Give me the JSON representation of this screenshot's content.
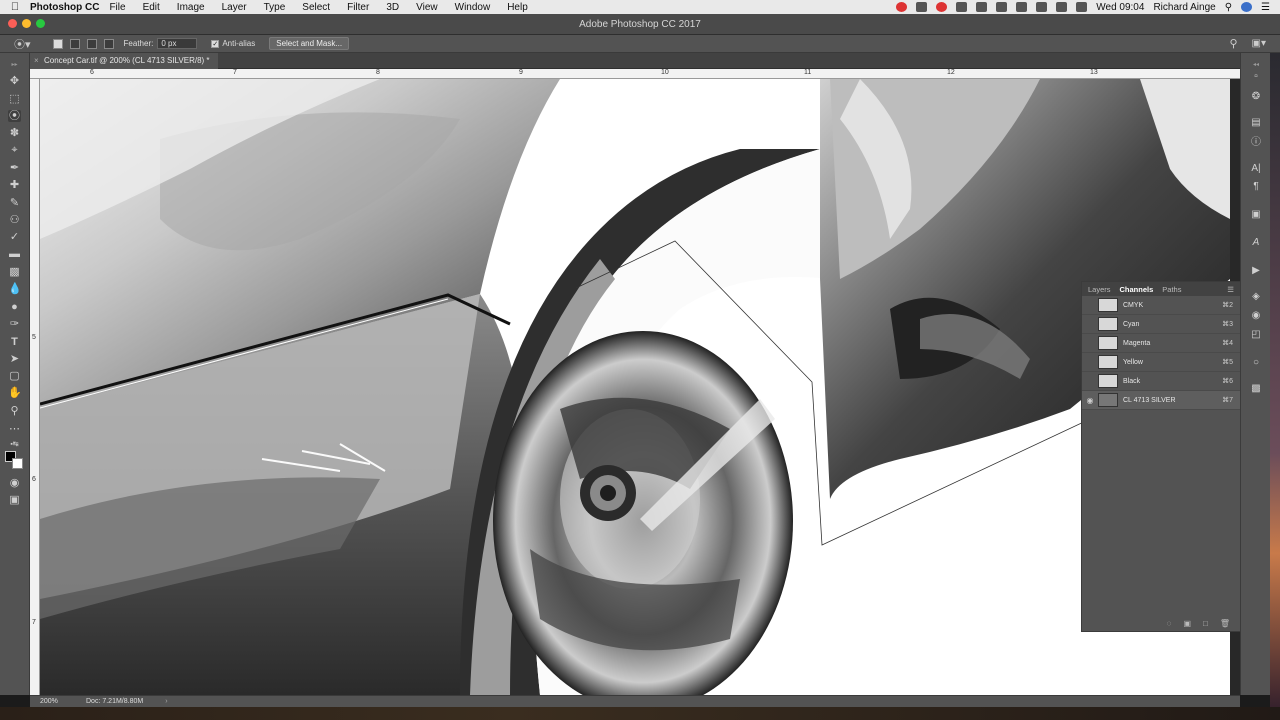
{
  "menubar": {
    "app_name": "Photoshop CC",
    "menus": [
      "File",
      "Edit",
      "Image",
      "Layer",
      "Type",
      "Select",
      "Filter",
      "3D",
      "View",
      "Window",
      "Help"
    ],
    "clock": "Wed 09:04",
    "user": "Richard Ainge"
  },
  "window": {
    "title": "Adobe Photoshop CC 2017"
  },
  "options": {
    "feather_label": "Feather:",
    "feather_value": "0 px",
    "antialias_label": "Anti-alias",
    "antialias_checked": true,
    "select_mask_label": "Select and Mask..."
  },
  "document": {
    "tab_title": "Concept Car.tif @ 200% (CL 4713 SILVER/8) *",
    "close_glyph": "×"
  },
  "rulers": {
    "horizontal": [
      "6",
      "7",
      "8",
      "9",
      "10",
      "11",
      "12",
      "13"
    ],
    "vertical": [
      "5",
      "6",
      "7"
    ]
  },
  "panel": {
    "tabs": [
      "Layers",
      "Channels",
      "Paths"
    ],
    "active_tab": "Channels",
    "channels": [
      {
        "name": "CMYK",
        "shortcut": "⌘2",
        "visible": false,
        "selected": false
      },
      {
        "name": "Cyan",
        "shortcut": "⌘3",
        "visible": false,
        "selected": false
      },
      {
        "name": "Magenta",
        "shortcut": "⌘4",
        "visible": false,
        "selected": false
      },
      {
        "name": "Yellow",
        "shortcut": "⌘5",
        "visible": false,
        "selected": false
      },
      {
        "name": "Black",
        "shortcut": "⌘6",
        "visible": false,
        "selected": false
      },
      {
        "name": "CL 4713 SILVER",
        "shortcut": "⌘7",
        "visible": true,
        "selected": true
      }
    ]
  },
  "status": {
    "zoom": "200%",
    "doc_size": "Doc: 7.21M/8.80M"
  }
}
